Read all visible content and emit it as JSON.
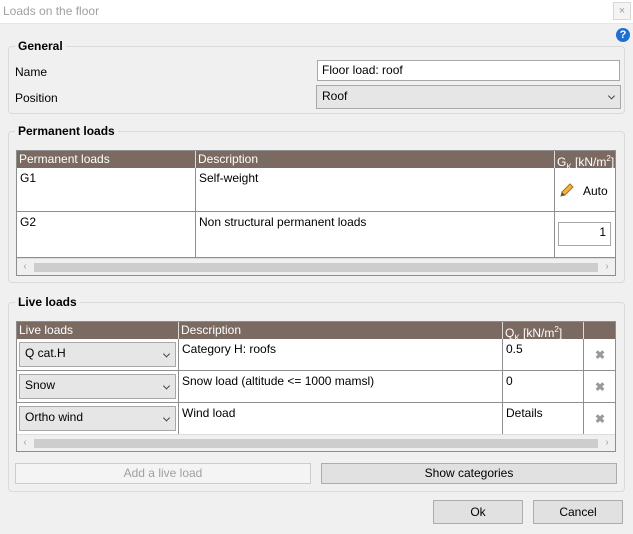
{
  "window": {
    "title": "Loads on the floor",
    "close_glyph": "×"
  },
  "help": {
    "icon": "help-icon",
    "glyph": "?"
  },
  "general": {
    "title": "General",
    "name_label": "Name",
    "name_value": "Floor load: roof",
    "position_label": "Position",
    "position_value": "Roof"
  },
  "permanent": {
    "title": "Permanent loads",
    "columns": {
      "load": "Permanent loads",
      "description": "Description",
      "unit_main": "G",
      "unit_sub": "K",
      "unit_rest": " [kN/m",
      "unit_sup": "2",
      "unit_end": "]"
    },
    "rows": [
      {
        "load": "G1",
        "description": "Self-weight",
        "value": "Auto",
        "icon": "pencil-icon"
      },
      {
        "load": "G2",
        "description": "Non structural permanent loads",
        "value": "1"
      }
    ]
  },
  "live": {
    "title": "Live loads",
    "columns": {
      "load": "Live loads",
      "description": "Description",
      "unit_main": "Q",
      "unit_sub": "K",
      "unit_rest": " [kN/m",
      "unit_sup": "2",
      "unit_end": "]"
    },
    "rows": [
      {
        "load": "Q cat.H",
        "description": "Category H: roofs",
        "value": "0.5"
      },
      {
        "load": "Snow",
        "description": "Snow load (altitude <= 1000 mamsl)",
        "value": "0"
      },
      {
        "load": "Ortho wind",
        "description": "Wind load",
        "value": "Details"
      }
    ],
    "delete_glyph": "✖"
  },
  "buttons": {
    "add_live_load": "Add a live load",
    "show_categories": "Show categories",
    "ok": "Ok",
    "cancel": "Cancel"
  },
  "scroll": {
    "left": "‹",
    "right": "›"
  }
}
